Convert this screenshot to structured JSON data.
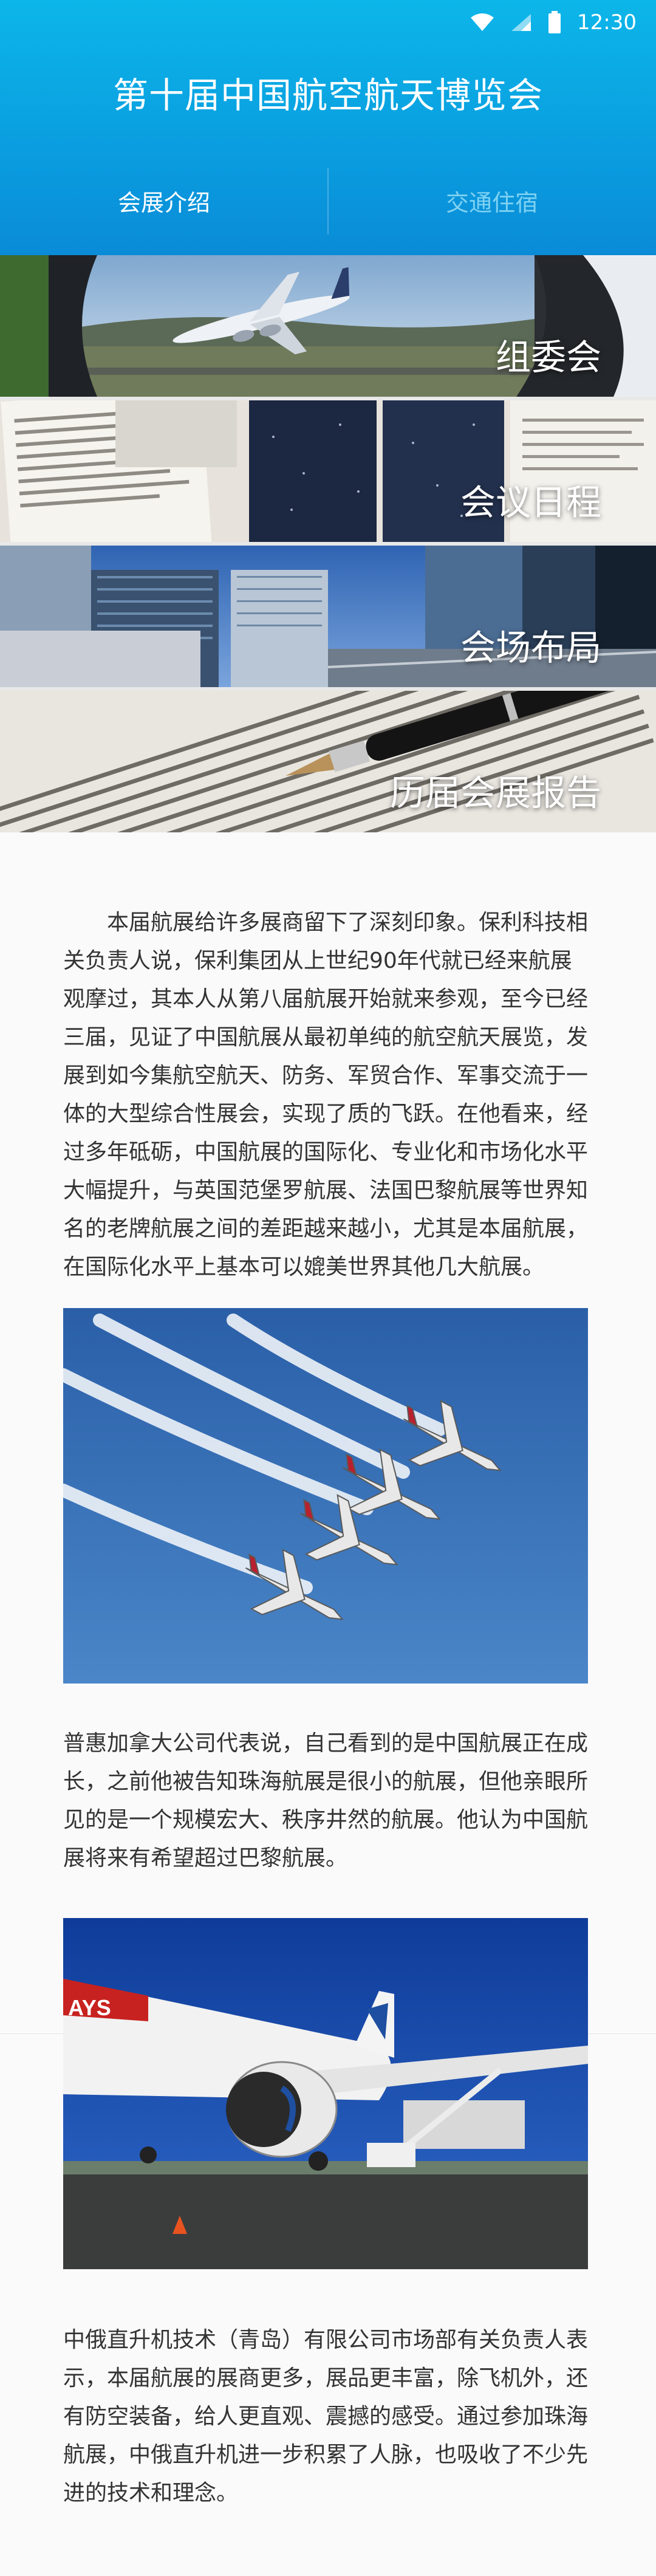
{
  "status_bar": {
    "time": "12:30",
    "icons": [
      "wifi-icon",
      "signal-icon",
      "battery-icon"
    ]
  },
  "header": {
    "title": "第十届中国航空航天博览会"
  },
  "tabs": [
    {
      "label": "会展介绍",
      "active": true
    },
    {
      "label": "交通住宿",
      "active": false
    }
  ],
  "banners": [
    {
      "label": "组委会",
      "image": "airliner-takeoff-through-window"
    },
    {
      "label": "会议日程",
      "image": "documents-and-tablets"
    },
    {
      "label": "会场布局",
      "image": "office-towers"
    },
    {
      "label": "历届会展报告",
      "image": "fountain-pen-on-text"
    }
  ],
  "article": {
    "paragraph1": "本届航展给许多展商留下了深刻印象。保利科技相关负责人说，保利集团从上世纪90年代就已经来航展观摩过，其本人从第八届航展开始就来参观，至今已经三届，见证了中国航展从最初单纯的航空航天展览，发展到如今集航空航天、防务、军贸合作、军事交流于一体的大型综合性展会，实现了质的飞跃。在他看来，经过多年砥砺，中国航展的国际化、专业化和市场化水平大幅提升，与英国范堡罗航展、法国巴黎航展等世界知名的老牌航展之间的差距越来越小，尤其是本届航展，在国际化水平上基本可以媲美世界其他几大航展。",
    "photo1": "four-jets-formation",
    "paragraph2": "普惠加拿大公司代表说，自己看到的是中国航展正在成长，之前他被告知珠海航展是很小的航展，但他亲眼所见的是一个规模宏大、秩序井然的航展。他认为中国航展将来有希望超过巴黎航展。",
    "photo2": "airliner-on-apron",
    "photo2_text": "AYS",
    "paragraph3": "中俄直升机技术（青岛）有限公司市场部有关负责人表示，本届航展的展商更多，展品更丰富，除飞机外，还有防空装备，给人更直观、震撼的感受。通过参加珠海航展，中俄直升机进一步积累了人脉，也吸收了不少先进的技术和理念。"
  },
  "colors": {
    "header_top": "#0cb6e9",
    "header_bottom": "#0a8bd7",
    "tab_inactive": "#7fd2f2",
    "body_bg": "#fafafb"
  }
}
